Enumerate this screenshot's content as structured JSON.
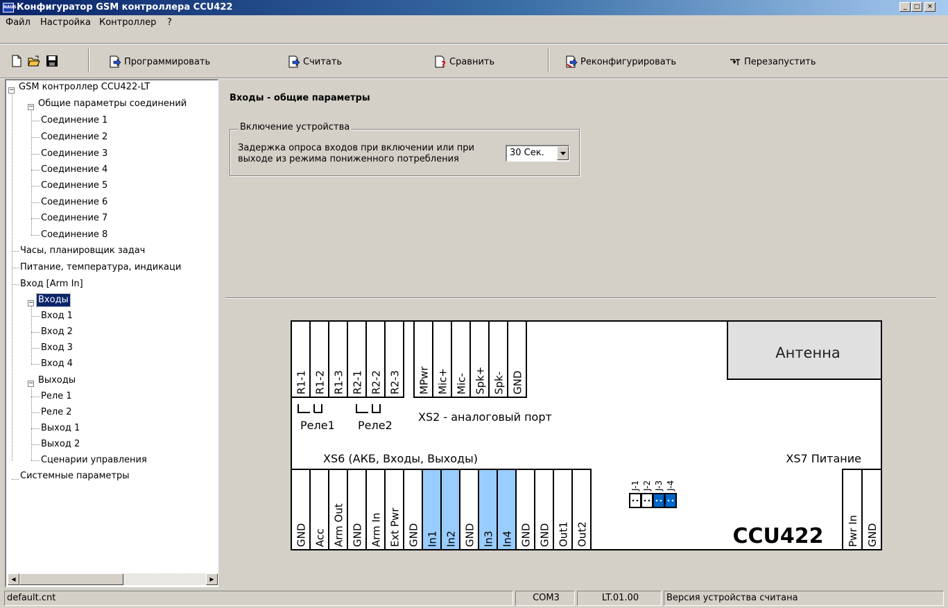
{
  "window": {
    "title": "Конфигуратор GSM контроллера CCU422",
    "icon_text": "NAUS"
  },
  "menu": {
    "items": [
      "Файл",
      "Настройка",
      "Контроллер",
      "?"
    ]
  },
  "toolbar": {
    "file_buttons": [
      "new-file-icon",
      "open-folder-icon",
      "save-disk-icon"
    ],
    "actions": [
      {
        "label": "Программировать",
        "icon": "program-icon"
      },
      {
        "label": "Считать",
        "icon": "read-icon"
      },
      {
        "label": "Сравнить",
        "icon": "compare-icon"
      },
      {
        "label": "Реконфигурировать",
        "icon": "reconfigure-icon"
      },
      {
        "label": "Перезапустить",
        "icon": "restart-icon"
      }
    ]
  },
  "tree": {
    "root": "GSM контроллер CCU422-LT",
    "connections_group": "Общие параметры соединений",
    "connections": [
      "Соединение 1",
      "Соединение 2",
      "Соединение 3",
      "Соединение 4",
      "Соединение 5",
      "Соединение 6",
      "Соединение 7",
      "Соединение 8"
    ],
    "clock": "Часы, планировщик задач",
    "power": "Питание, температура, индикаци",
    "arm_input": "Вход [Arm In]",
    "inputs_group": "Входы",
    "inputs": [
      "Вход 1",
      "Вход 2",
      "Вход 3",
      "Вход 4"
    ],
    "outputs_group": "Выходы",
    "outputs": [
      "Реле 1",
      "Реле 2",
      "Выход 1",
      "Выход 2",
      "Сценарии управления"
    ],
    "system": "Системные параметры",
    "selected": "Входы"
  },
  "panel": {
    "title": "Входы - общие параметры",
    "group_title": "Включение устройства",
    "field_label": "Задержка опроса входов при включении или при выходе из режима пониженного потребления",
    "delay_value": "30 Сек."
  },
  "board": {
    "top_terminals": [
      "R1-1",
      "R1-2",
      "R1-3",
      "R2-1",
      "R2-2",
      "R2-3"
    ],
    "audio_terminals": [
      "MPwr",
      "Mic+",
      "Mic-",
      "Spk+",
      "Spk-",
      "GND"
    ],
    "relay1_label": "Реле1",
    "relay2_label": "Реле2",
    "xs2_label": "XS2 - аналоговый порт",
    "antenna_label": "Антенна",
    "xs6_label": "XS6 (АКБ, Входы, Выходы)",
    "xs7_label": "XS7 Питание",
    "bottom_terminals": [
      "GND",
      "Acc",
      "Arm Out",
      "GND",
      "Arm In",
      "Ext Pwr",
      "GND",
      "In1",
      "In2",
      "GND",
      "In3",
      "In4",
      "GND",
      "GND",
      "Out1",
      "Out2"
    ],
    "highlighted_terminals": [
      "In1",
      "In2",
      "In3",
      "In4"
    ],
    "jumpers": [
      "J-1",
      "J-2",
      "J-3",
      "J-4"
    ],
    "jumpers_set": [
      "J-3",
      "J-4"
    ],
    "model": "CCU422",
    "power_terminals": [
      "Pwr In",
      "GND"
    ],
    "highlight_color": "#99ccff",
    "jumper_color": "#0066cc"
  },
  "status": {
    "file": "default.cnt",
    "port": "COM3",
    "version": "LT.01.00",
    "message": "Версия устройства считана"
  }
}
